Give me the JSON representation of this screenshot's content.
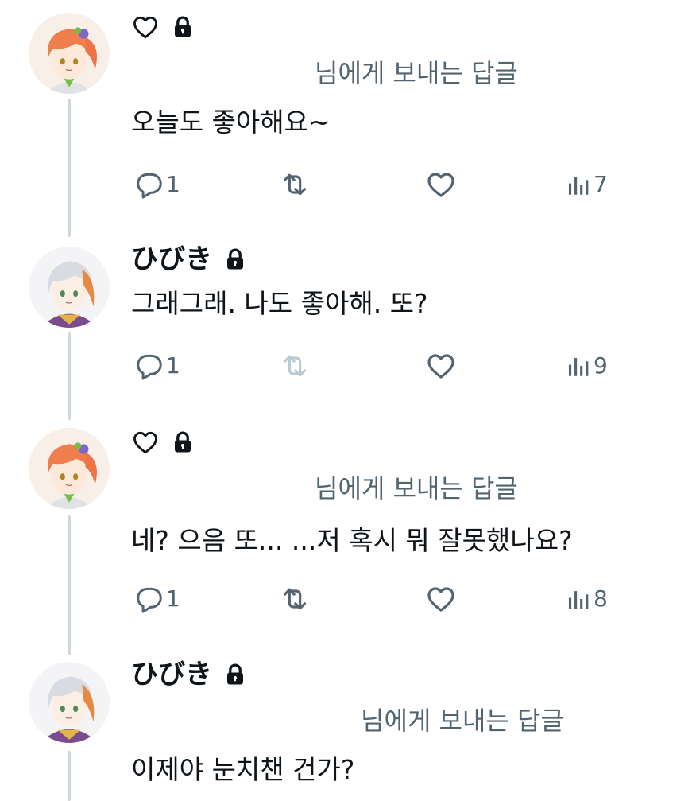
{
  "colors": {
    "text_primary": "#0f1419",
    "text_secondary": "#536471",
    "thread_line": "#cfd9de",
    "retweet_disabled": "#b9cad3"
  },
  "tweets": [
    {
      "avatar": "orange-haired-anime-avatar",
      "display_name": "",
      "header_icons": [
        "heart-icon",
        "lock-icon"
      ],
      "reply_to": "님에게 보내는 답글",
      "text": "오늘도 좋아해요~",
      "reply_count": "1",
      "retweet_disabled": false,
      "views": "7"
    },
    {
      "avatar": "silver-haired-anime-avatar",
      "display_name": "ひびき",
      "header_icons": [
        "lock-icon"
      ],
      "reply_to": "",
      "text": "그래그래. 나도 좋아해. 또?",
      "reply_count": "1",
      "retweet_disabled": true,
      "views": "9"
    },
    {
      "avatar": "orange-haired-anime-avatar",
      "display_name": "",
      "header_icons": [
        "heart-icon",
        "lock-icon"
      ],
      "reply_to": "님에게 보내는 답글",
      "text": "네? 으음 또... ...저 혹시 뭐 잘못했나요?",
      "reply_count": "1",
      "retweet_disabled": false,
      "views": "8"
    },
    {
      "avatar": "silver-haired-anime-avatar",
      "display_name": "ひびき",
      "header_icons": [
        "lock-icon"
      ],
      "reply_to": "님에게 보내는 답글",
      "text": "이제야 눈치챈 건가?"
    }
  ]
}
